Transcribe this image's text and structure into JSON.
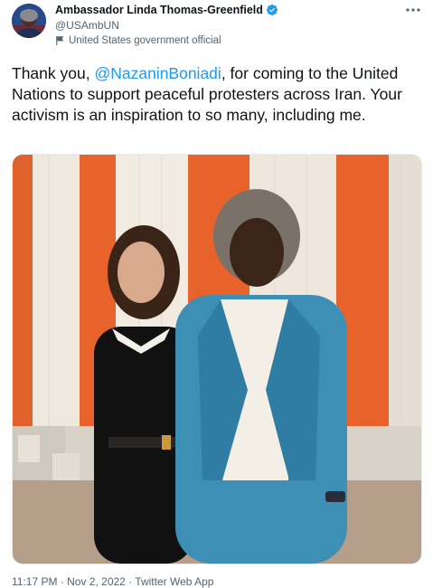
{
  "tweet": {
    "author": {
      "display_name": "Ambassador Linda Thomas-Greenfield",
      "handle": "@USAmbUN",
      "label": "United States government official",
      "verified": true
    },
    "more_icon": "more-icon",
    "text": {
      "before": "Thank you, ",
      "mention": "@NazaninBoniadi",
      "after": ", for coming to the United Nations to support peaceful protesters across Iran. Your activism is an inspiration to so many, including me."
    },
    "media": {
      "kind": "photo"
    },
    "timestamp": "11:17 PM · Nov 2, 2022 · Twitter Web App"
  },
  "colors": {
    "link": "#1d9bf0",
    "secondary_text": "#536471",
    "verified": "#1d9bf0"
  }
}
